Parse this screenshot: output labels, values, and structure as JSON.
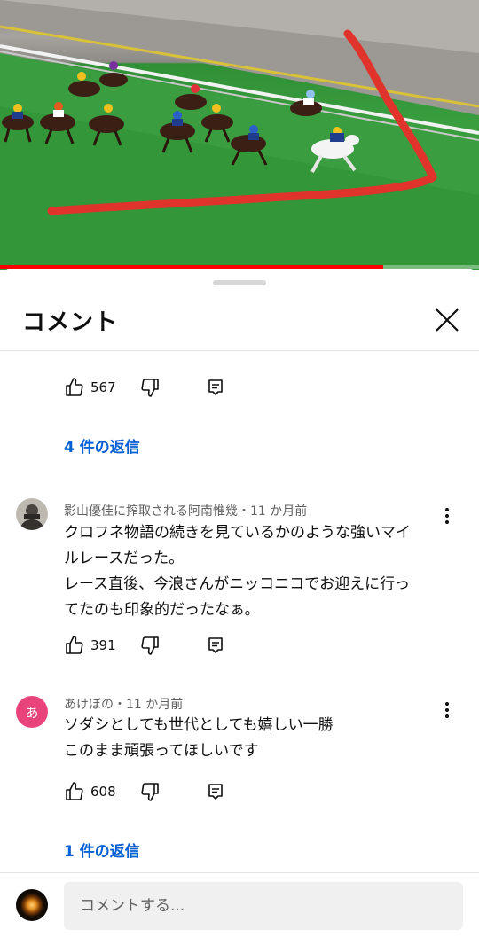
{
  "video": {
    "progress_fraction": 0.8
  },
  "panel": {
    "title": "コメント"
  },
  "thread0": {
    "likes": "567",
    "replies": "4 件の返信"
  },
  "comments": [
    {
      "author_meta": "影山優佳に搾取される阿南惟幾・11 か月前",
      "lines": [
        "クロフネ物語の続きを見ているかのような強いマイ",
        "ルレースだった。",
        "レース直後、今浪さんがニッコニコでお迎えに行っ",
        "てたのも印象的だったなぁ。"
      ],
      "likes": "391"
    },
    {
      "author_meta": "あけぼの・11 か月前",
      "avatar_letter": "あ",
      "avatar_color": "#e8437a",
      "lines": [
        "ソダシとしても世代としても嬉しい一勝",
        "このまま頑張ってほしいです"
      ],
      "likes": "608",
      "replies": "1 件の返信"
    }
  ],
  "composer": {
    "placeholder": "コメントする..."
  },
  "colors": {
    "link": "#065fd4",
    "progress": "#ff0000",
    "annotation_stroke": "#e0332b"
  }
}
